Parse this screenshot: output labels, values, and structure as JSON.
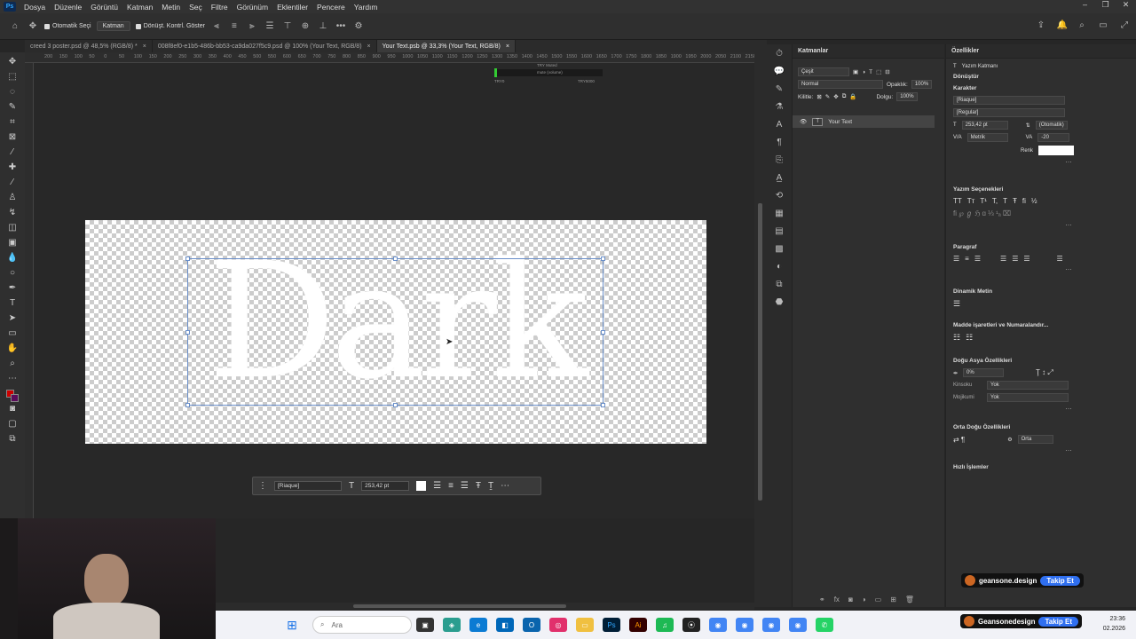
{
  "menubar": {
    "app_icon": "Ps",
    "items": [
      "Dosya",
      "Düzenle",
      "Görüntü",
      "Katman",
      "Metin",
      "Seç",
      "Filtre",
      "Görünüm",
      "Eklentiler",
      "Pencere",
      "Yardım"
    ]
  },
  "options": {
    "auto_select": "Otomatik Seçi",
    "auto_target": "Katman",
    "transform_controls": "Dönüşt. Kontrl. Göster"
  },
  "tabs": [
    "creed 3 poster.psd @ 48,5% (RGB/8) *",
    "008f8ef0-e1b5-486b-bb53-ca9da027f5c9.psd @ 100% (Your Text, RGB/8)",
    "Your Text.psb @ 33,3% (Your Text, RGB/8)"
  ],
  "ruler": [
    "200",
    "150",
    "100",
    "50",
    "0",
    "50",
    "100",
    "150",
    "200",
    "250",
    "300",
    "350",
    "400",
    "450",
    "500",
    "550",
    "600",
    "650",
    "700",
    "750",
    "800",
    "850",
    "900",
    "950",
    "1000",
    "1050",
    "1100",
    "1150",
    "1200",
    "1250",
    "1300",
    "1350",
    "1400",
    "1450",
    "1500",
    "1550",
    "1600",
    "1650",
    "1700",
    "1750",
    "1800",
    "1850",
    "1900",
    "1950",
    "2000",
    "2050",
    "2100",
    "2150",
    "2200"
  ],
  "canvas": {
    "text": "Dark"
  },
  "indicator": {
    "top": "TRY Muted",
    "mid": "mute (volume)",
    "left": "TRY0",
    "right": "TRY5000"
  },
  "context": {
    "font": "[Riaque]",
    "size": "253,42 pt"
  },
  "layers": {
    "title": "Katmanlar",
    "filter": "Çeşit",
    "blend": "Normal",
    "opacity_label": "Opaklık:",
    "opacity": "100%",
    "lock_label": "Kilitle:",
    "fill_label": "Dolgu:",
    "fill": "100%",
    "layer_name": "Your Text",
    "layer_thumb": "T"
  },
  "props": {
    "title": "Özellikler",
    "kind": "Yazım Katmanı",
    "transform": "Dönüştür",
    "char": "Karakter",
    "font": "[Riaque]",
    "style": "[Regular]",
    "size": "253,42 pt",
    "leading": "(Otomatik)",
    "kerning": "Metrik",
    "tracking": "-20",
    "color_label": "Renk",
    "type_options": "Yazım Seçenekleri",
    "type_glyphs": [
      "TT",
      "Tт",
      "T¹",
      "T,",
      "T",
      "Ŧ",
      "fi",
      "½"
    ],
    "paragraph": "Paragraf",
    "dynamic": "Dinamik Metin",
    "bullets": "Madde işaretleri ve Numaralandır...",
    "east_asian": "Doğu Asya Özellikleri",
    "ea_val": "0%",
    "kinsoku_label": "Kinsoku",
    "kinsoku": "Yok",
    "mojikumi_label": "Mojikumi",
    "mojikumi": "Yok",
    "me": "Orta Doğu Özellikleri",
    "me_val": "Orta",
    "quick": "Hızlı İşlemler"
  },
  "badge1": {
    "name": "geansone.design",
    "follow": "Takip Et"
  },
  "badge2": {
    "name": "Geansonedesign",
    "follow": "Takip Et"
  },
  "taskbar": {
    "search": "Ara",
    "time": "23:36",
    "date": "02.2026"
  }
}
